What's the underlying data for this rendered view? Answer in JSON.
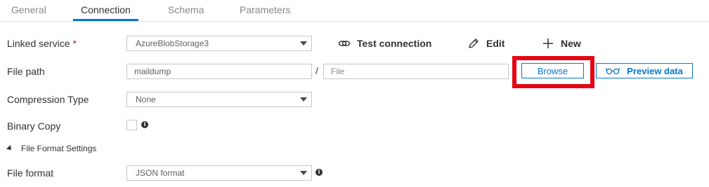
{
  "tabs": [
    {
      "label": "General"
    },
    {
      "label": "Connection"
    },
    {
      "label": "Schema"
    },
    {
      "label": "Parameters"
    }
  ],
  "linked_service": {
    "label": "Linked service",
    "required_mark": "*",
    "value": "AzureBlobStorage3",
    "test_connection_label": "Test connection",
    "edit_label": "Edit",
    "new_label": "New"
  },
  "file_path": {
    "label": "File path",
    "container_value": "maildump",
    "separator": "/",
    "file_placeholder": "File",
    "browse_label": "Browse",
    "preview_label": "Preview data"
  },
  "compression": {
    "label": "Compression Type",
    "value": "None"
  },
  "binary_copy": {
    "label": "Binary Copy",
    "checked": false,
    "info": "i"
  },
  "file_format_settings": {
    "label": "File Format Settings"
  },
  "file_format": {
    "label": "File format",
    "value": "JSON format",
    "info": "i"
  },
  "colors": {
    "accent": "#0078d4",
    "highlight": "#e30613",
    "required": "#a4262c"
  }
}
